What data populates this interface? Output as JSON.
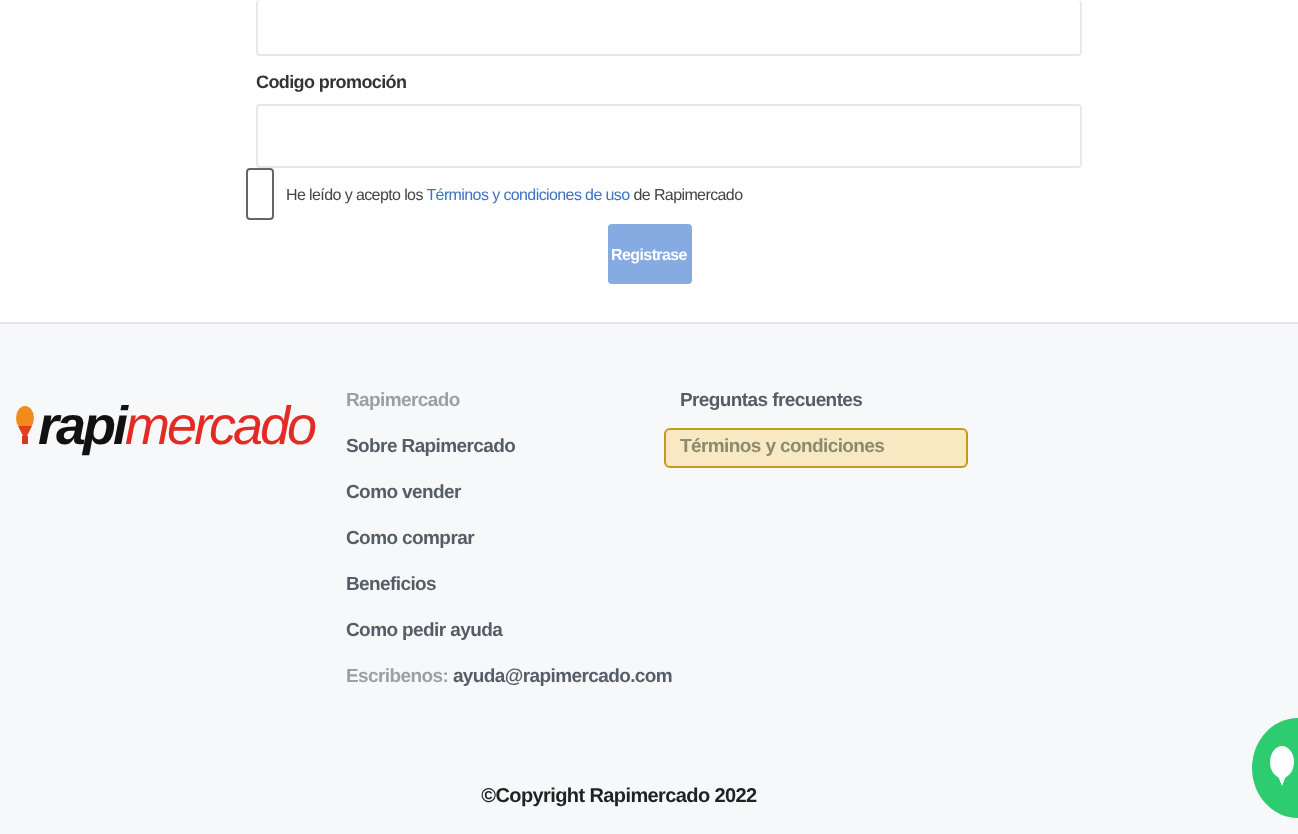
{
  "form": {
    "promo_label": "Codigo promoción",
    "terms": {
      "checked": false,
      "before": "He leído y acepto los",
      "link": "Términos y condiciones de uso",
      "after": "de Rapimercado"
    },
    "submit": {
      "label": "Registrase",
      "disabled": true
    }
  },
  "footer": {
    "logo": {
      "part_1": "rapi",
      "part_2": "mercado"
    },
    "column_1": [
      {
        "kind": "heading",
        "text": "Rapimercado"
      },
      {
        "kind": "link",
        "text": "Sobre Rapimercado"
      },
      {
        "kind": "link",
        "text": "Como vender"
      },
      {
        "kind": "link",
        "text": "Como comprar"
      },
      {
        "kind": "link",
        "text": "Beneficios"
      },
      {
        "kind": "link",
        "text": "Como pedir ayuda"
      },
      {
        "kind": "contact",
        "text": "Escribenos:",
        "value": "ayuda@rapimercado.com"
      }
    ],
    "column_2": [
      {
        "text": "Preguntas frecuentes",
        "highlighted": false
      },
      {
        "text": "Términos y condiciones",
        "highlighted": true
      }
    ],
    "copyright": "©Copyright Rapimercado 2022"
  }
}
